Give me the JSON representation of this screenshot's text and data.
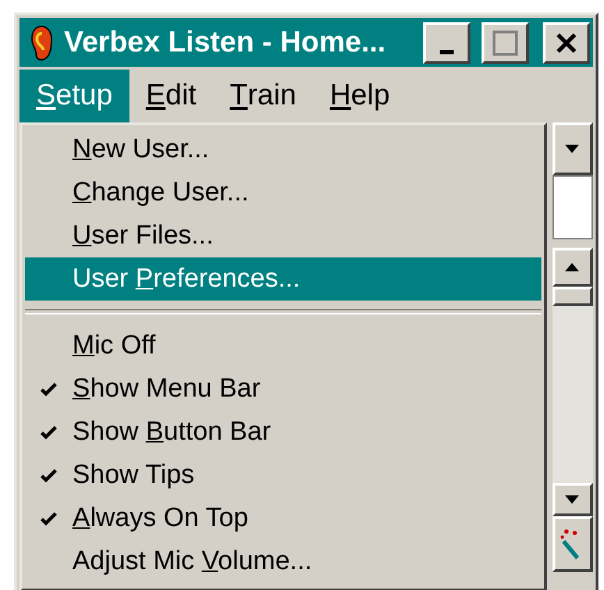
{
  "window": {
    "title": "Verbex Listen - Home..."
  },
  "menubar": [
    {
      "label": {
        "key": "S",
        "post": "etup"
      },
      "selected": true
    },
    {
      "label": {
        "key": "E",
        "post": "dit"
      },
      "selected": false
    },
    {
      "label": {
        "key": "T",
        "post": "rain"
      },
      "selected": false
    },
    {
      "label": {
        "key": "H",
        "post": "elp"
      },
      "selected": false
    }
  ],
  "menu_items": [
    {
      "kind": "item",
      "label": {
        "key": "N",
        "post": "ew User..."
      },
      "checked": false,
      "selected": false
    },
    {
      "kind": "item",
      "label": {
        "key": "C",
        "post": "hange User..."
      },
      "checked": false,
      "selected": false
    },
    {
      "kind": "item",
      "label": {
        "key": "U",
        "post": "ser Files..."
      },
      "checked": false,
      "selected": false
    },
    {
      "kind": "item",
      "label": {
        "pre": "User ",
        "key": "P",
        "post": "references..."
      },
      "checked": false,
      "selected": true
    },
    {
      "kind": "separator"
    },
    {
      "kind": "item",
      "label": {
        "key": "M",
        "post": "ic Off"
      },
      "checked": false,
      "selected": false
    },
    {
      "kind": "item",
      "label": {
        "key": "S",
        "post": "how Menu Bar"
      },
      "checked": true,
      "selected": false
    },
    {
      "kind": "item",
      "label": {
        "pre": "Show ",
        "key": "B",
        "post": "utton Bar"
      },
      "checked": true,
      "selected": false
    },
    {
      "kind": "item",
      "label": {
        "pre": "Show Tips"
      },
      "checked": true,
      "selected": false
    },
    {
      "kind": "item",
      "label": {
        "key": "A",
        "post": "lways On Top"
      },
      "checked": true,
      "selected": false
    },
    {
      "kind": "item",
      "label": {
        "pre": "Adjust Mic ",
        "key": "V",
        "post": "olume..."
      },
      "checked": false,
      "selected": false
    }
  ]
}
